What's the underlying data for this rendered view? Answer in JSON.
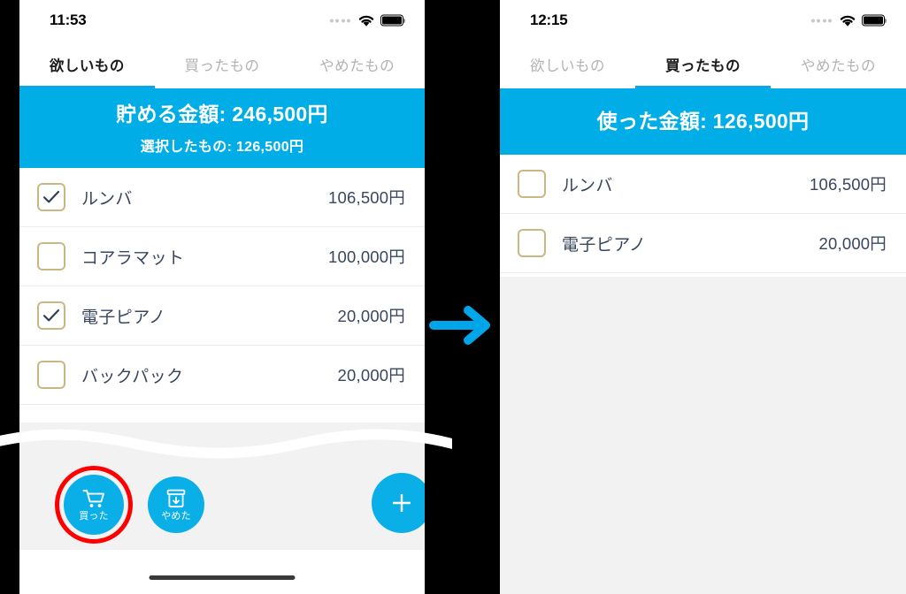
{
  "theme": {
    "accent_blue": "#00ade6",
    "fab_blue": "#0aafe8",
    "highlight_red": "#ff0000",
    "checkbox_border": "#cbb784",
    "text_navy": "#39465e",
    "inactive_tab": "#b3b3b3",
    "page_background": "#000000",
    "list_empty_bg": "#f2f2f2"
  },
  "arrow": {
    "icon": "arrow-right-icon",
    "color": "#00a6e8"
  },
  "screens": [
    {
      "id": "wishlist-screen",
      "status_bar": {
        "time": "11:53",
        "signal_icon": "signal-dots-icon",
        "wifi_icon": "wifi-icon",
        "battery_icon": "battery-full-icon"
      },
      "tabs": [
        {
          "label": "欲しいもの",
          "active": true
        },
        {
          "label": "買ったもの",
          "active": false
        },
        {
          "label": "やめたもの",
          "active": false
        }
      ],
      "summary": {
        "main": "貯める金額: 246,500円",
        "sub": "選択したもの: 126,500円"
      },
      "items": [
        {
          "name": "ルンバ",
          "price": "106,500円",
          "checked": true
        },
        {
          "name": "コアラマット",
          "price": "100,000円",
          "checked": false
        },
        {
          "name": "電子ピアノ",
          "price": "20,000円",
          "checked": true
        },
        {
          "name": "バックパック",
          "price": "20,000円",
          "checked": false
        }
      ],
      "toolbar": {
        "bought_button": {
          "label": "買った",
          "icon": "shopping-cart-icon",
          "highlighted": true
        },
        "dropped_button": {
          "label": "やめた",
          "icon": "archive-box-down-icon",
          "highlighted": false
        },
        "add_button": {
          "label": "+",
          "icon": "plus-icon"
        }
      },
      "home_indicator": true
    },
    {
      "id": "purchased-screen",
      "status_bar": {
        "time": "12:15",
        "signal_icon": "signal-dots-icon",
        "wifi_icon": "wifi-icon",
        "battery_icon": "battery-full-icon"
      },
      "tabs": [
        {
          "label": "欲しいもの",
          "active": false
        },
        {
          "label": "買ったもの",
          "active": true
        },
        {
          "label": "やめたもの",
          "active": false
        }
      ],
      "summary": {
        "main": "使った金額: 126,500円",
        "sub": ""
      },
      "items": [
        {
          "name": "ルンバ",
          "price": "106,500円",
          "checked": false
        },
        {
          "name": "電子ピアノ",
          "price": "20,000円",
          "checked": false
        }
      ],
      "toolbar": null,
      "home_indicator": false
    }
  ]
}
